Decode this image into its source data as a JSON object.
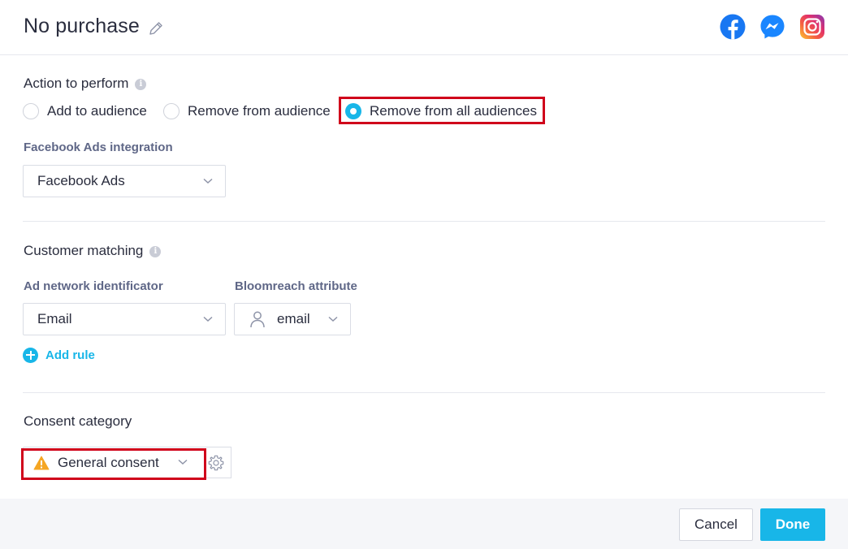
{
  "header": {
    "title": "No purchase",
    "icons": [
      "pencil-icon",
      "facebook-icon",
      "messenger-icon",
      "instagram-icon"
    ]
  },
  "action": {
    "label": "Action to perform",
    "options": [
      {
        "label": "Add to audience",
        "checked": false
      },
      {
        "label": "Remove from audience",
        "checked": false
      },
      {
        "label": "Remove from all audiences",
        "checked": true
      }
    ]
  },
  "integration": {
    "label": "Facebook Ads integration",
    "value": "Facebook Ads"
  },
  "matching": {
    "label": "Customer matching",
    "identifier_label": "Ad network identificator",
    "identifier_value": "Email",
    "attribute_label": "Bloomreach attribute",
    "attribute_value": "email",
    "add_rule": "Add rule"
  },
  "consent": {
    "label": "Consent category",
    "value": "General consent"
  },
  "footer": {
    "cancel": "Cancel",
    "done": "Done"
  },
  "colors": {
    "accent": "#18b6e8",
    "highlight": "#d0021b",
    "warning": "#f5a623"
  }
}
